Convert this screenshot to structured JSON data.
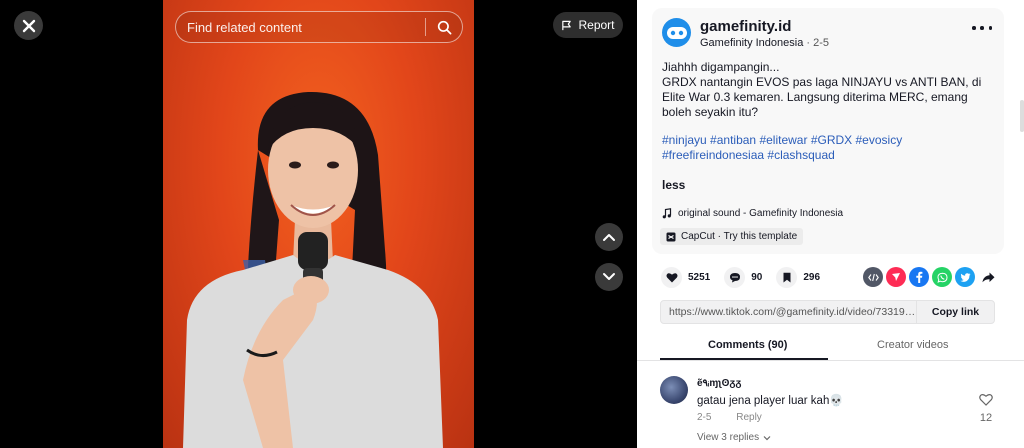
{
  "player": {
    "search_placeholder": "Find related content",
    "report_label": "Report"
  },
  "post": {
    "username": "gamefinity.id",
    "display_name": "Gamefinity Indonesia",
    "date": "2-5",
    "description_lines": [
      "Jiahhh digampangin...",
      "GRDX nantangin EVOS pas laga NINJAYU vs ANTI BAN, di Elite War 0.3 kemaren. Langsung diterima MERC, emang boleh seyakin itu?"
    ],
    "hashtags": [
      "#ninjayu",
      "#antiban",
      "#elitewar",
      "#GRDX",
      "#evosicy",
      "#freefireindonesiaa",
      "#clashsquad"
    ],
    "less_label": "less",
    "sound": "original sound - Gamefinity Indonesia",
    "capcut": "CapCut · Try this template"
  },
  "stats": {
    "likes": "5251",
    "comments": "90",
    "saves": "296"
  },
  "share_icons": [
    "embed-icon",
    "send-icon",
    "facebook-icon",
    "whatsapp-icon",
    "twitter-icon",
    "share-arrow-icon"
  ],
  "link": {
    "url": "https://www.tiktok.com/@gamefinity.id/video/733194...",
    "copy_label": "Copy link"
  },
  "tabs": {
    "comments": "Comments (90)",
    "creator": "Creator videos"
  },
  "comment": {
    "name": "ẽ٩ᵢɱʅʘᵹᵹ",
    "text": "gatau jena player luar kah💀",
    "date": "2-5",
    "reply_label": "Reply",
    "likes": "12",
    "view_replies": "View 3 replies"
  },
  "colors": {
    "accent_blue": "#2b5db9",
    "video_bg": "#e2461a",
    "facebook": "#1877f2",
    "whatsapp": "#25d366",
    "twitter": "#1da1f2",
    "send": "#fe2c55"
  }
}
